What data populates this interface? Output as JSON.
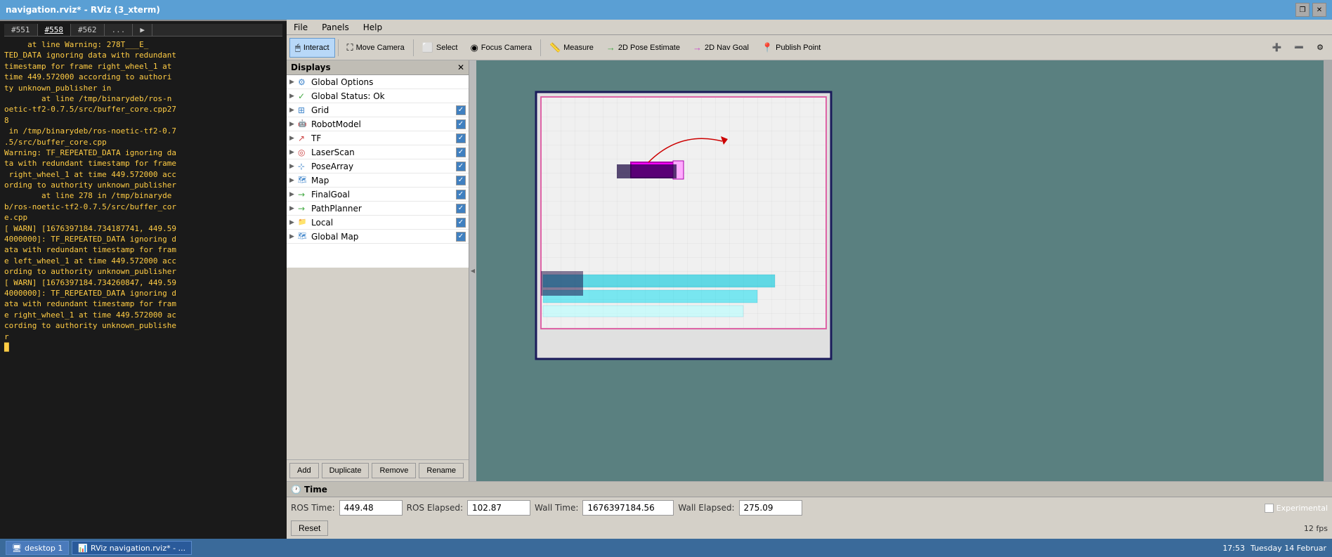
{
  "title_bar": {
    "title": "navigation.rviz* - RViz (3_xterm)",
    "close_label": "✕",
    "restore_label": "❐"
  },
  "menu": {
    "file": "File",
    "panels": "Panels",
    "help": "Help"
  },
  "toolbar": {
    "interact": "Interact",
    "move_camera": "Move Camera",
    "select": "Select",
    "focus_camera": "Focus Camera",
    "measure": "Measure",
    "pose_estimate": "2D Pose Estimate",
    "nav_goal": "2D Nav Goal",
    "publish_point": "Publish Point"
  },
  "displays": {
    "header": "Displays",
    "items": [
      {
        "name": "Global Options",
        "icon": "⚙",
        "color": "#4488cc",
        "expanded": false,
        "has_check": false
      },
      {
        "name": "Global Status: Ok",
        "icon": "✓",
        "color": "#44aa44",
        "expanded": false,
        "has_check": false
      },
      {
        "name": "Grid",
        "icon": "⊞",
        "color": "#4488cc",
        "expanded": false,
        "has_check": true,
        "checked": true
      },
      {
        "name": "RobotModel",
        "icon": "🤖",
        "color": "#4488cc",
        "expanded": false,
        "has_check": true,
        "checked": true
      },
      {
        "name": "TF",
        "icon": "↗",
        "color": "#cc4444",
        "expanded": false,
        "has_check": true,
        "checked": true
      },
      {
        "name": "LaserScan",
        "icon": "◎",
        "color": "#cc4444",
        "expanded": false,
        "has_check": true,
        "checked": true
      },
      {
        "name": "PoseArray",
        "icon": "⊹",
        "color": "#4488cc",
        "expanded": false,
        "has_check": true,
        "checked": true
      },
      {
        "name": "Map",
        "icon": "🗺",
        "color": "#4488cc",
        "expanded": false,
        "has_check": true,
        "checked": true
      },
      {
        "name": "FinalGoal",
        "icon": "→",
        "color": "#44aa44",
        "expanded": false,
        "has_check": true,
        "checked": true
      },
      {
        "name": "PathPlanner",
        "icon": "→",
        "color": "#44aa44",
        "expanded": false,
        "has_check": true,
        "checked": true
      },
      {
        "name": "Local",
        "icon": "📁",
        "color": "#4488cc",
        "expanded": false,
        "has_check": true,
        "checked": true
      },
      {
        "name": "Global Map",
        "icon": "🗺",
        "color": "#4488cc",
        "expanded": false,
        "has_check": true,
        "checked": true
      }
    ],
    "buttons": {
      "add": "Add",
      "duplicate": "Duplicate",
      "remove": "Remove",
      "rename": "Rename"
    }
  },
  "time": {
    "header": "Time",
    "ros_time_label": "ROS Time:",
    "ros_time_value": "449.48",
    "ros_elapsed_label": "ROS Elapsed:",
    "ros_elapsed_value": "102.87",
    "wall_time_label": "Wall Time:",
    "wall_time_value": "1676397184.56",
    "wall_elapsed_label": "Wall Elapsed:",
    "wall_elapsed_value": "275.09",
    "reset_label": "Reset",
    "fps_label": "12 fps",
    "experimental_label": "Experimental"
  },
  "taskbar": {
    "desktop_label": "desktop 1",
    "rviz_label": "RViz navigation.rviz* - ...",
    "time_label": "17:53",
    "date_label": "Tuesday 14 Februar"
  },
  "terminal": {
    "tabs": [
      "#551",
      "#558",
      "#562",
      "...",
      "▶"
    ],
    "active_tab": "#558",
    "content": "     at line Warning: 278T___E_\nTED_DATA ignoring data with redundant\ntimestamp for frame right_wheel_1 at\ntime 449.572000 according to authori\nty unknown_publisher in\n        at line /tmp/binarydeb/ros-n\noetic-tf2-0.7.5/src/buffer_core.cpp27\n8\n in /tmp/binarydeb/ros-noetic-tf2-0.7\n.5/src/buffer_core.cpp\nWarning: TF_REPEATED_DATA ignoring da\nta with redundant timestamp for frame\n right_wheel_1 at time 449.572000 acc\nording to authority unknown_publisher\n        at line 278 in /tmp/binaryde\nb/ros-noetic-tf2-0.7.5/src/buffer_cor\ne.cpp\n[ WARN] [1676397184.734187741, 449.59\n4000000]: TF_REPEATED_DATA ignoring d\nata with redundant timestamp for fram\ne left_wheel_1 at time 449.572000 acc\nording to authority unknown_publisher\n[ WARN] [1676397184.734260847, 449.59\n4000000]: TF_REPEATED_DATA ignoring d\nata with redundant timestamp for fram\ne right_wheel_1 at time 449.572000 ac\ncording to authority unknown_publishe\nr\n█"
  }
}
